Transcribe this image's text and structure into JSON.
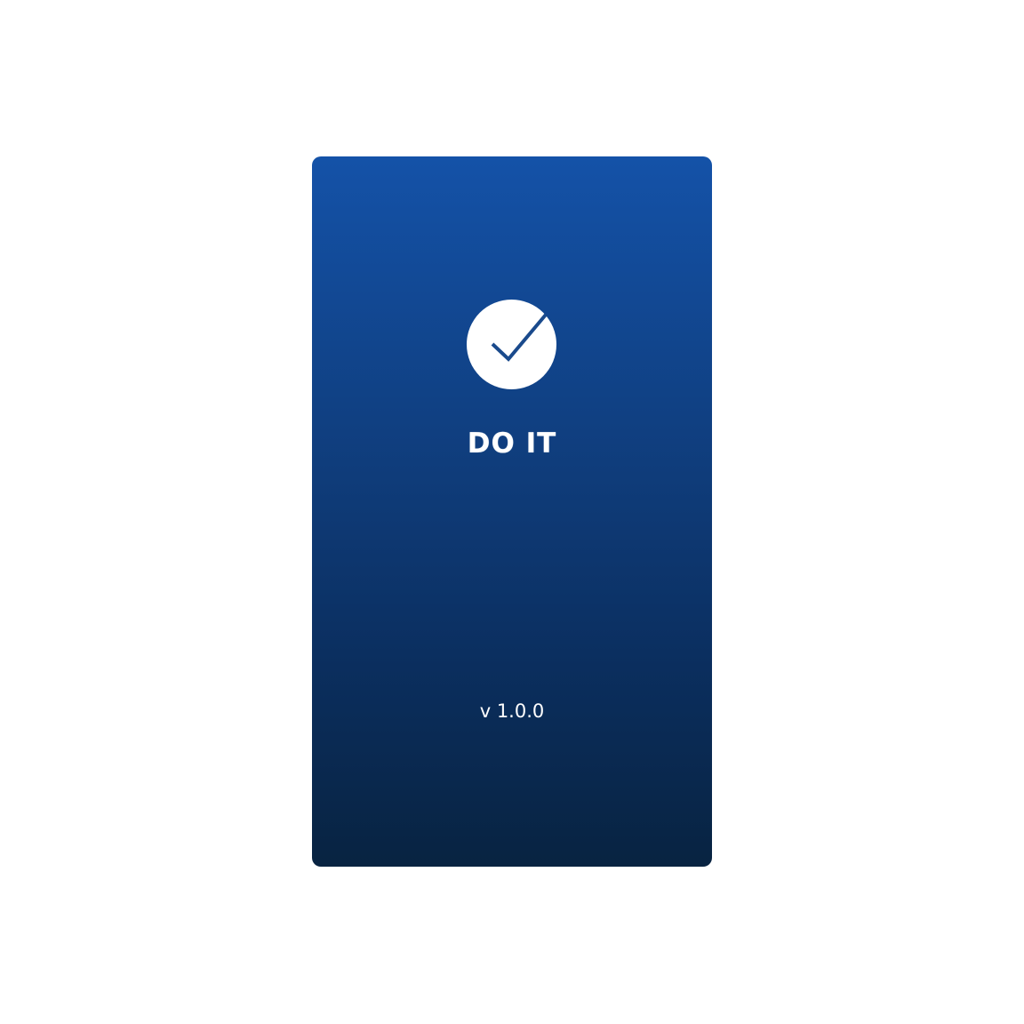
{
  "splash": {
    "app_name": "DO IT",
    "version": "v 1.0.0",
    "logo_icon": "checkmark-circle-icon"
  },
  "colors": {
    "page_background": "#ffffff",
    "gradient_top": "#1452a8",
    "gradient_bottom": "#082341",
    "logo_background": "#ffffff",
    "checkmark": "#1a4a8c",
    "text": "#ffffff"
  }
}
